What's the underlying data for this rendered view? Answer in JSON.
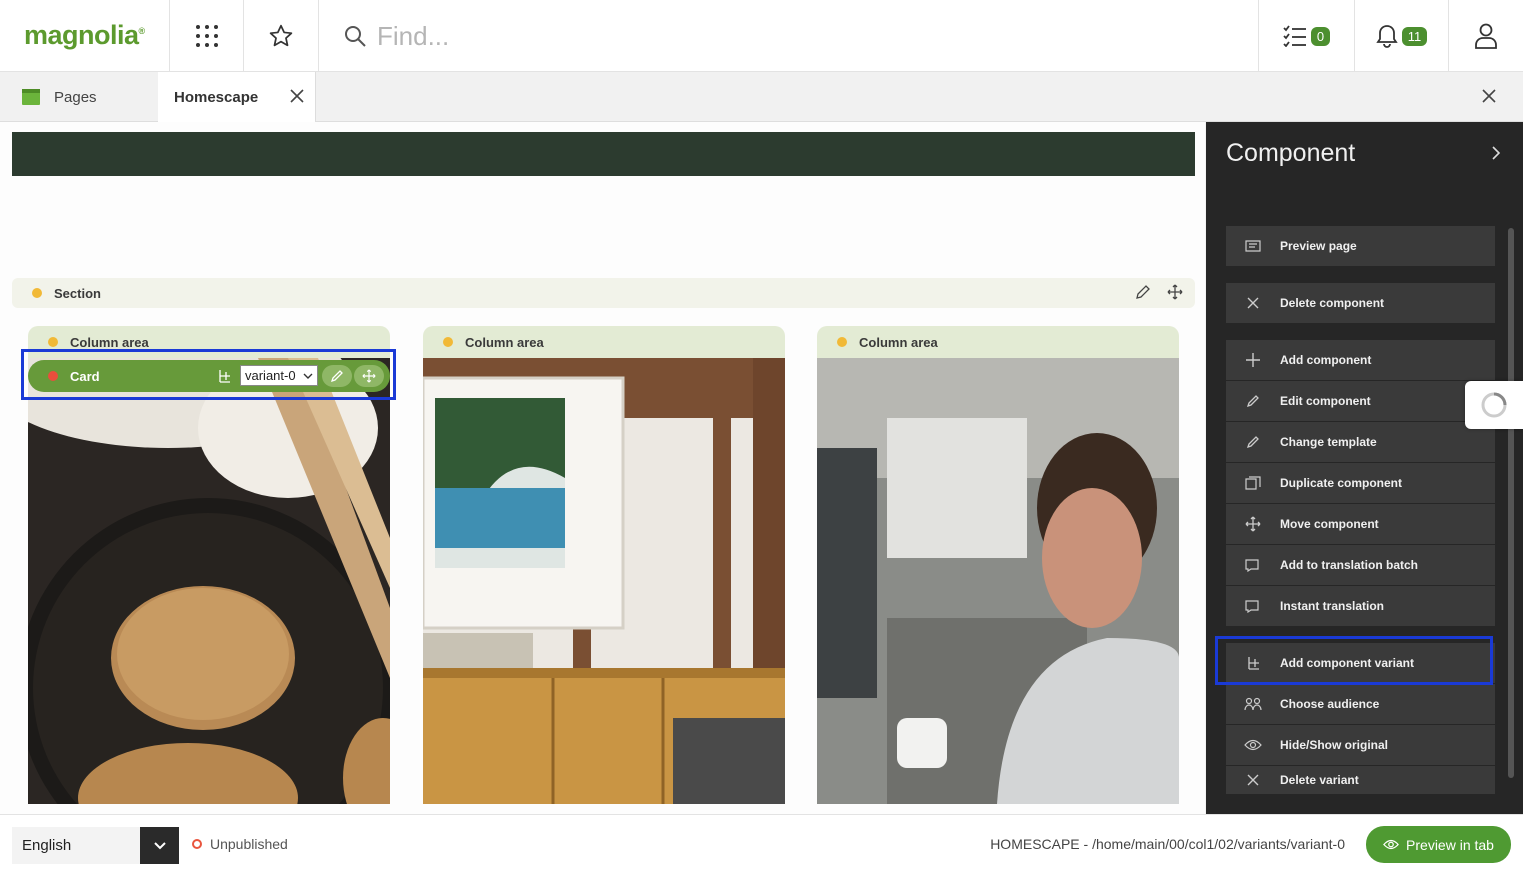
{
  "app": {
    "logo_text": "magnolia",
    "logo_mark": "®",
    "brand_color": "#5c9a2e"
  },
  "topbar": {
    "apps_icon": "grid-icon",
    "favorites_icon": "star-icon",
    "search_placeholder": "Find...",
    "tasks_count": "0",
    "notifications_count": "11"
  },
  "tabs": {
    "pages_label": "Pages",
    "active_label": "Homescape"
  },
  "canvas": {
    "section_label": "Section",
    "columns": [
      {
        "label": "Column area"
      },
      {
        "label": "Column area"
      },
      {
        "label": "Column area"
      }
    ],
    "card": {
      "label": "Card",
      "variant_value": "variant-0"
    }
  },
  "panel": {
    "title": "Component",
    "actions": [
      {
        "label": "Preview page",
        "icon": "preview-icon"
      },
      {
        "label": "Delete component",
        "icon": "close-icon"
      },
      {
        "label": "Add component",
        "icon": "plus-icon"
      },
      {
        "label": "Edit component",
        "icon": "pencil-icon"
      },
      {
        "label": "Change template",
        "icon": "pencil-icon"
      },
      {
        "label": "Duplicate component",
        "icon": "duplicate-icon"
      },
      {
        "label": "Move component",
        "icon": "move-icon"
      },
      {
        "label": "Add to translation batch",
        "icon": "translation-icon"
      },
      {
        "label": "Instant translation",
        "icon": "translation-icon"
      },
      {
        "label": "Add component variant",
        "icon": "variant-icon"
      },
      {
        "label": "Choose audience",
        "icon": "audience-icon"
      },
      {
        "label": "Hide/Show original",
        "icon": "eye-icon"
      },
      {
        "label": "Delete variant",
        "icon": "close-icon"
      }
    ]
  },
  "bottombar": {
    "language": "English",
    "status": "Unpublished",
    "path": "HOMESCAPE - /home/main/00/col1/02/variants/variant-0",
    "preview_button": "Preview in tab"
  },
  "colors": {
    "accent_green": "#4f9a32",
    "panel_bg": "#262626",
    "highlight_blue": "#1a3ad6"
  }
}
